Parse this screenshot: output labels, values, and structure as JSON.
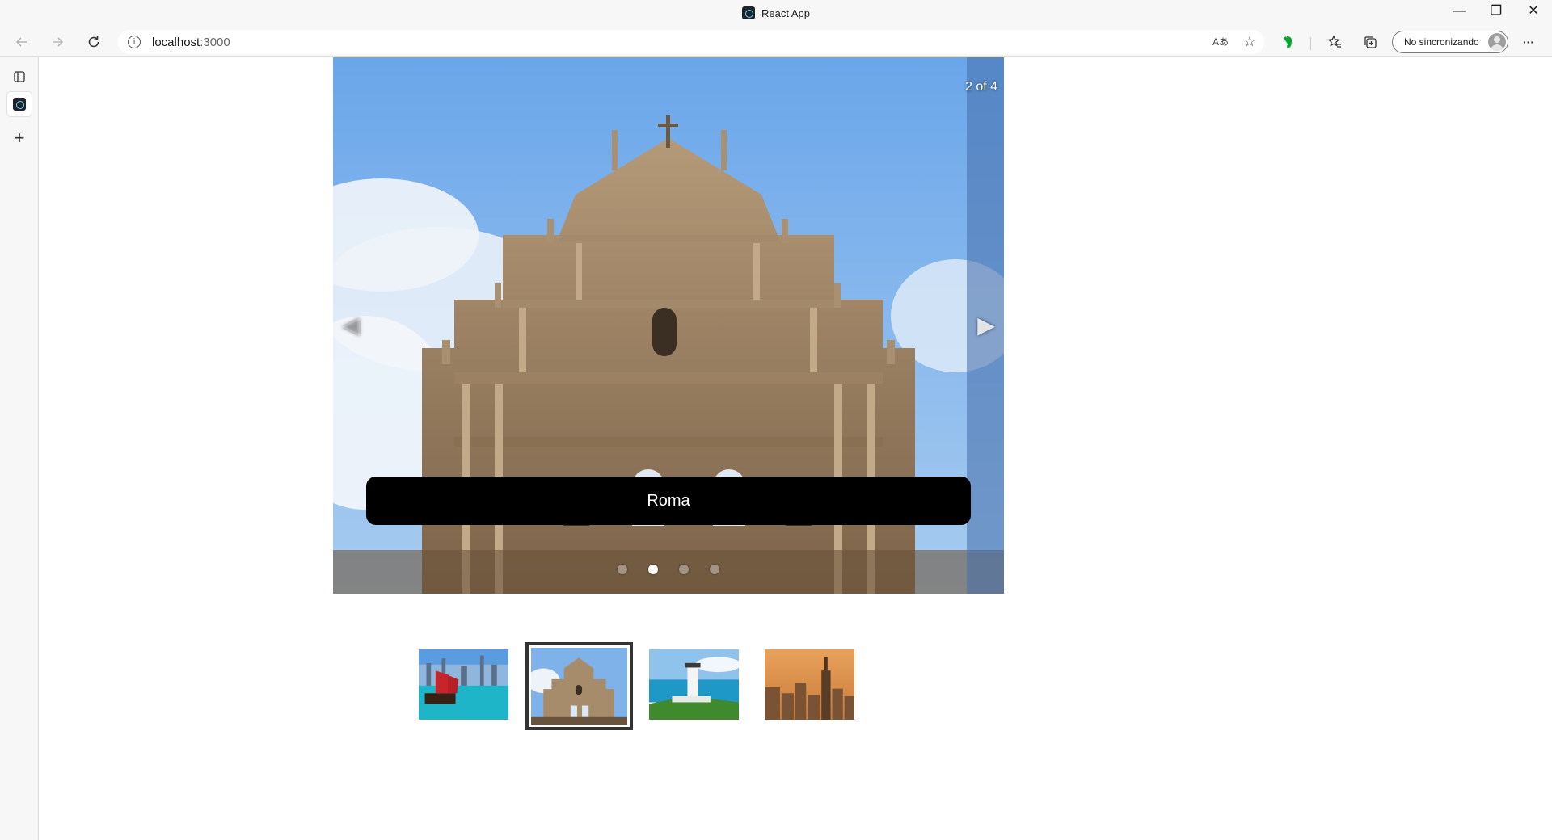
{
  "window": {
    "title": "React App",
    "controls": {
      "minimize": "—",
      "restore": "❐",
      "close": "✕"
    }
  },
  "toolbar": {
    "back_icon": "arrow-left-icon",
    "forward_icon": "arrow-right-icon",
    "refresh_icon": "refresh-icon",
    "url_host": "localhost",
    "url_port": ":3000",
    "read_aloud_icon": "Aあ",
    "favorite_add_icon": "☆",
    "evernote_icon": "evernote-icon",
    "favorites_icon": "favorites-icon",
    "collections_icon": "collections-icon",
    "profile_label": "No sincronizando",
    "more_icon": "···"
  },
  "sidebar": {
    "items": [
      {
        "name": "tab-actions",
        "icon": "❐"
      },
      {
        "name": "react-app-tab",
        "icon": "react-favicon"
      },
      {
        "name": "new-tab",
        "icon": "+"
      }
    ]
  },
  "carousel": {
    "counter": "2 of 4",
    "legend": "Roma",
    "prev_arrow": "◀",
    "next_arrow": "▶",
    "total_slides": 4,
    "selected_index": 2,
    "thumbnails": [
      {
        "name": "hong-kong-harbor"
      },
      {
        "name": "ruins-of-st-pauls"
      },
      {
        "name": "lighthouse-coast"
      },
      {
        "name": "new-york-skyline"
      }
    ]
  }
}
